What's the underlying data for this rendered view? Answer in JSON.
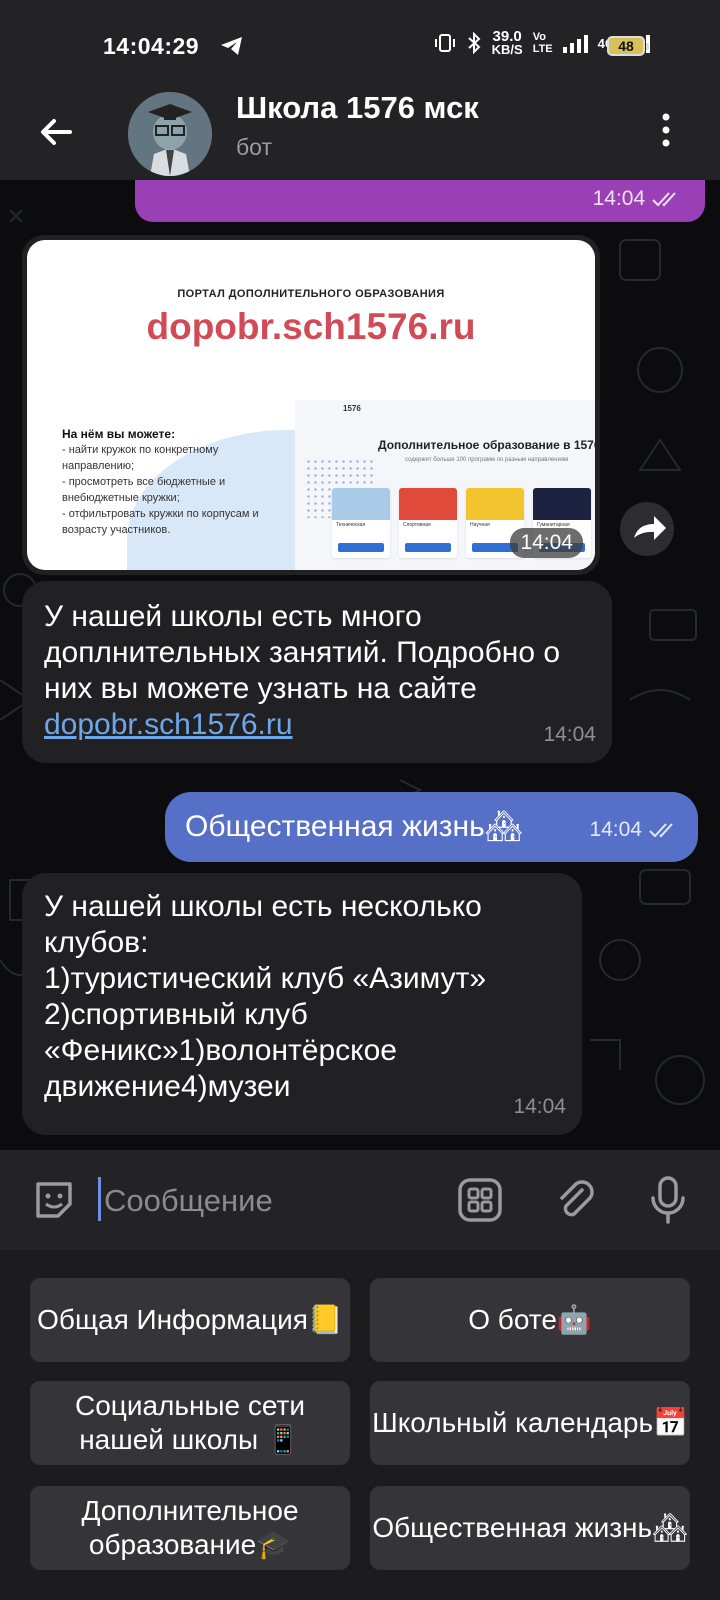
{
  "status_bar": {
    "time": "14:04:29",
    "net_speed_value": "39.0",
    "net_speed_unit": "KB/S",
    "volte_top": "Vo",
    "volte_bottom": "LTE",
    "network": "4G",
    "battery": "48"
  },
  "header": {
    "title": "Школа 1576 мск",
    "subtitle": "бот"
  },
  "messages": {
    "top_outgoing_time": "14:04",
    "photo": {
      "portal_heading": "ПОРТАЛ ДОПОЛНИТЕЛЬНОГО ОБРАЗОВАНИЯ",
      "url": "dopobr.sch1576.ru",
      "list_title": "На нём вы можете:",
      "list_items": [
        "- найти кружок по конкретному направлению;",
        "- просмотреть все бюджетные и внебюджетные кружки;",
        "- отфильтровать кружки по корпусам и возрасту участников."
      ],
      "site_logo": "1576",
      "site_title": "Дополнительное образование в 1576",
      "site_subtitle": "содержит больше 100 программ по разным направлениям",
      "cards": [
        "Техническая",
        "Спортивная",
        "Научная",
        "Гуманитарная"
      ],
      "time": "14:04"
    },
    "msg1": {
      "text": "У нашей школы есть много доплнительных занятий. Подробно о них вы можете узнать на сайте ",
      "link": "dopobr.sch1576.ru",
      "time": "14:04"
    },
    "msg2": {
      "text": "Общественная жизнь🏘",
      "time": "14:04"
    },
    "msg3": {
      "lines": [
        "У нашей школы есть несколько",
        "клубов:",
        "1)туристический клуб «Азимут»",
        "2)спортивный клуб",
        "«Феникс»1)волонтёрское",
        "движение4)музеи"
      ],
      "time": "14:04"
    }
  },
  "input": {
    "placeholder": "Сообщение"
  },
  "keyboard": {
    "buttons": [
      "Общая Информация📒",
      "О боте🤖",
      "Социальные сети нашей школы 📱",
      "Школьный календарь📅",
      "Дополнительное образование🎓",
      "Общественная жизнь🏘"
    ]
  },
  "colors": {
    "outgoing_purple": "#9a3fb5",
    "outgoing_blue": "#5670c8",
    "incoming": "#212124",
    "link": "#6ea7e8",
    "header_bg": "#232325"
  }
}
